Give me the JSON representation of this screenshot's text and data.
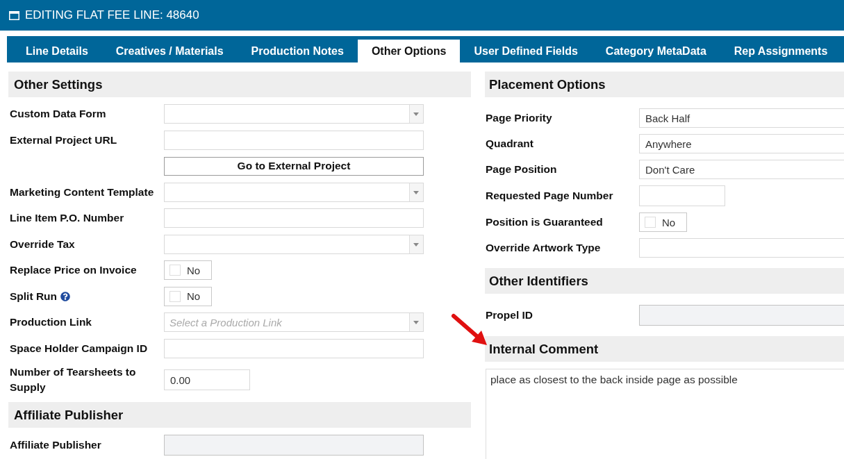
{
  "window": {
    "title": "EDITING FLAT FEE LINE: 48640"
  },
  "tabs": [
    {
      "label": "Line Details",
      "selected": false
    },
    {
      "label": "Creatives / Materials",
      "selected": false
    },
    {
      "label": "Production Notes",
      "selected": false
    },
    {
      "label": "Other Options",
      "selected": true
    },
    {
      "label": "User Defined Fields",
      "selected": false
    },
    {
      "label": "Category MetaData",
      "selected": false
    },
    {
      "label": "Rep Assignments",
      "selected": false
    }
  ],
  "panels": [
    {
      "sections": [
        {
          "title": "Other Settings",
          "annotated": false,
          "rows": [
            {
              "kind": "select",
              "label": "Custom Data Form",
              "help": false,
              "disabled": false
            },
            {
              "kind": "text",
              "label": "External Project URL",
              "help": false,
              "disabled": false
            },
            {
              "kind": "button",
              "text": "Go to External Project",
              "disabled": false
            },
            {
              "kind": "select",
              "label": "Marketing Content Template",
              "help": false,
              "disabled": false
            },
            {
              "kind": "text",
              "label": "Line Item P.O. Number",
              "help": false,
              "disabled": false
            },
            {
              "kind": "select",
              "label": "Override Tax",
              "help": false,
              "disabled": false
            },
            {
              "kind": "checkbox",
              "label": "Replace Price on Invoice",
              "value": "No",
              "checked": false,
              "help": false,
              "disabled": false
            },
            {
              "kind": "checkbox",
              "label": "Split Run",
              "value": "No",
              "checked": false,
              "help": true,
              "disabled": false
            },
            {
              "kind": "select",
              "label": "Production Link",
              "placeholder": "Select a Production Link",
              "help": false,
              "disabled": false
            },
            {
              "kind": "text",
              "label": "Space Holder Campaign ID",
              "help": false,
              "disabled": false
            },
            {
              "kind": "number",
              "label": "Number of Tearsheets to Supply",
              "value": "0.00",
              "help": false,
              "disabled": false
            }
          ]
        },
        {
          "title": "Affiliate Publisher",
          "annotated": false,
          "rows": [
            {
              "kind": "text",
              "label": "Affiliate Publisher",
              "help": false,
              "disabled": true
            }
          ]
        }
      ]
    },
    {
      "sections": [
        {
          "title": "Placement Options",
          "annotated": false,
          "rows": [
            {
              "kind": "text",
              "label": "Page Priority",
              "value": "Back Half",
              "help": false,
              "disabled": false
            },
            {
              "kind": "text",
              "label": "Quadrant",
              "value": "Anywhere",
              "help": false,
              "disabled": false
            },
            {
              "kind": "text",
              "label": "Page Position",
              "value": "Don't Care",
              "help": false,
              "disabled": false
            },
            {
              "kind": "number",
              "label": "Requested Page Number",
              "help": false,
              "disabled": false
            },
            {
              "kind": "checkbox",
              "label": "Position is Guaranteed",
              "value": "No",
              "checked": false,
              "help": false,
              "disabled": false
            },
            {
              "kind": "text",
              "label": "Override Artwork Type",
              "help": false,
              "disabled": false
            }
          ]
        },
        {
          "title": "Other Identifiers",
          "annotated": false,
          "rows": [
            {
              "kind": "text",
              "label": "Propel ID",
              "help": false,
              "disabled": true
            }
          ]
        },
        {
          "title": "Internal Comment",
          "annotated": true,
          "rows": [
            {
              "kind": "textarea",
              "value": "place as closest to the back inside page as possible",
              "disabled": false
            }
          ]
        }
      ]
    }
  ]
}
